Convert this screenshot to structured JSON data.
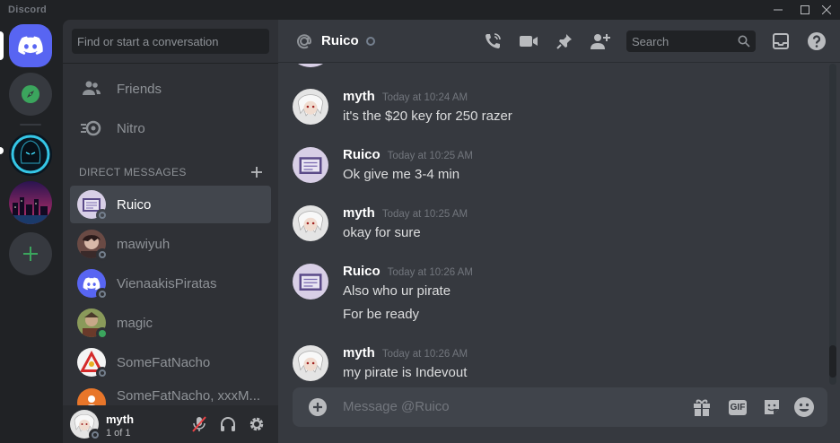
{
  "app": {
    "title": "Discord"
  },
  "colors": {
    "blurple": "#5865f2",
    "online": "#3ba55d",
    "offline": "#747f8d",
    "explore_green": "#3ba55d"
  },
  "sidebar": {
    "search_placeholder": "Find or start a conversation",
    "nav": [
      {
        "label": "Friends",
        "icon": "friends-icon"
      },
      {
        "label": "Nitro",
        "icon": "nitro-icon"
      }
    ],
    "dm_header": "DIRECT MESSAGES",
    "dms": [
      {
        "name": "Ruico",
        "status": "offline",
        "active": true
      },
      {
        "name": "mawiyuh",
        "status": "offline",
        "active": false
      },
      {
        "name": "VienaakisPiratas",
        "status": "offline",
        "active": false
      },
      {
        "name": "magic",
        "status": "online",
        "active": false
      },
      {
        "name": "SomeFatNacho",
        "status": "offline",
        "active": false
      },
      {
        "name": "SomeFatNacho, xxxM...",
        "status": "none",
        "active": false
      }
    ]
  },
  "user": {
    "name": "myth",
    "tag": "1 of 1"
  },
  "chat": {
    "recipient": "Ruico",
    "search_placeholder": "Search",
    "composer_placeholder": "Message @Ruico",
    "gif_label": "GIF",
    "messages": [
      {
        "author": "myth",
        "time": "Today at 10:24 AM",
        "lines": [
          "it's the $20 key for 250 razer"
        ]
      },
      {
        "author": "Ruico",
        "time": "Today at 10:25 AM",
        "lines": [
          "Ok give me 3-4 min"
        ]
      },
      {
        "author": "myth",
        "time": "Today at 10:25 AM",
        "lines": [
          "okay for sure"
        ]
      },
      {
        "author": "Ruico",
        "time": "Today at 10:26 AM",
        "lines": [
          "Also who ur pirate",
          "For be ready"
        ]
      },
      {
        "author": "myth",
        "time": "Today at 10:26 AM",
        "lines": [
          "my pirate is Indevout"
        ]
      }
    ]
  }
}
